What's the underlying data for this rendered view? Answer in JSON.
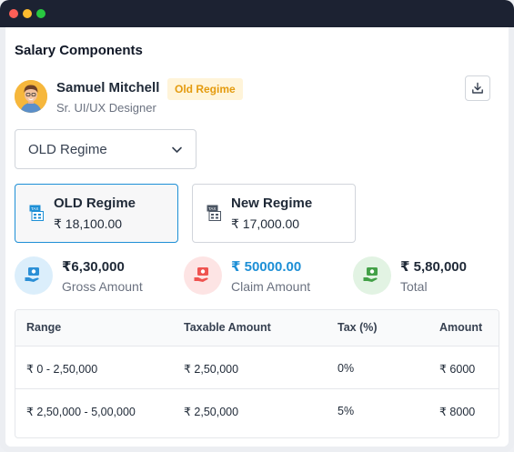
{
  "window": {
    "controls": [
      "close",
      "minimize",
      "maximize"
    ]
  },
  "page": {
    "title": "Salary Components"
  },
  "user": {
    "name": "Samuel Mitchell",
    "badge": "Old Regime",
    "role": "Sr. UI/UX Designer",
    "avatar_icon": "avatar-person"
  },
  "actions": {
    "download_icon": "download-icon"
  },
  "regime_select": {
    "value": "OLD Regime",
    "icon": "chevron-down-icon"
  },
  "regimes": [
    {
      "title": "OLD Regime",
      "value": "₹ 18,100.00",
      "selected": true,
      "icon": "tax-icon"
    },
    {
      "title": "New Regime",
      "value": "₹ 17,000.00",
      "selected": false,
      "icon": "tax-icon"
    }
  ],
  "stats": [
    {
      "value": "₹6,30,000",
      "label": "Gross Amount",
      "icon": "money-hand-icon",
      "color": "#2b8fd6"
    },
    {
      "value": "₹ 50000.00",
      "label": "Claim Amount",
      "icon": "money-hand-icon",
      "color": "#ef5350"
    },
    {
      "value": "₹ 5,80,000",
      "label": "Total",
      "icon": "money-hand-icon",
      "color": "#43a047"
    }
  ],
  "table": {
    "headers": [
      "Range",
      "Taxable Amount",
      "Tax (%)",
      "Amount"
    ],
    "rows": [
      [
        "₹ 0 - 2,50,000",
        "₹ 2,50,000",
        "0%",
        "₹ 6000"
      ],
      [
        "₹ 2,50,000 - 5,00,000",
        "₹ 2,50,000",
        "5%",
        "₹ 8000"
      ]
    ]
  },
  "colors": {
    "accent": "#1d8fd6",
    "badge_text": "#e49b0f",
    "badge_bg": "#fff4d9",
    "titlebar": "#1c2232"
  }
}
